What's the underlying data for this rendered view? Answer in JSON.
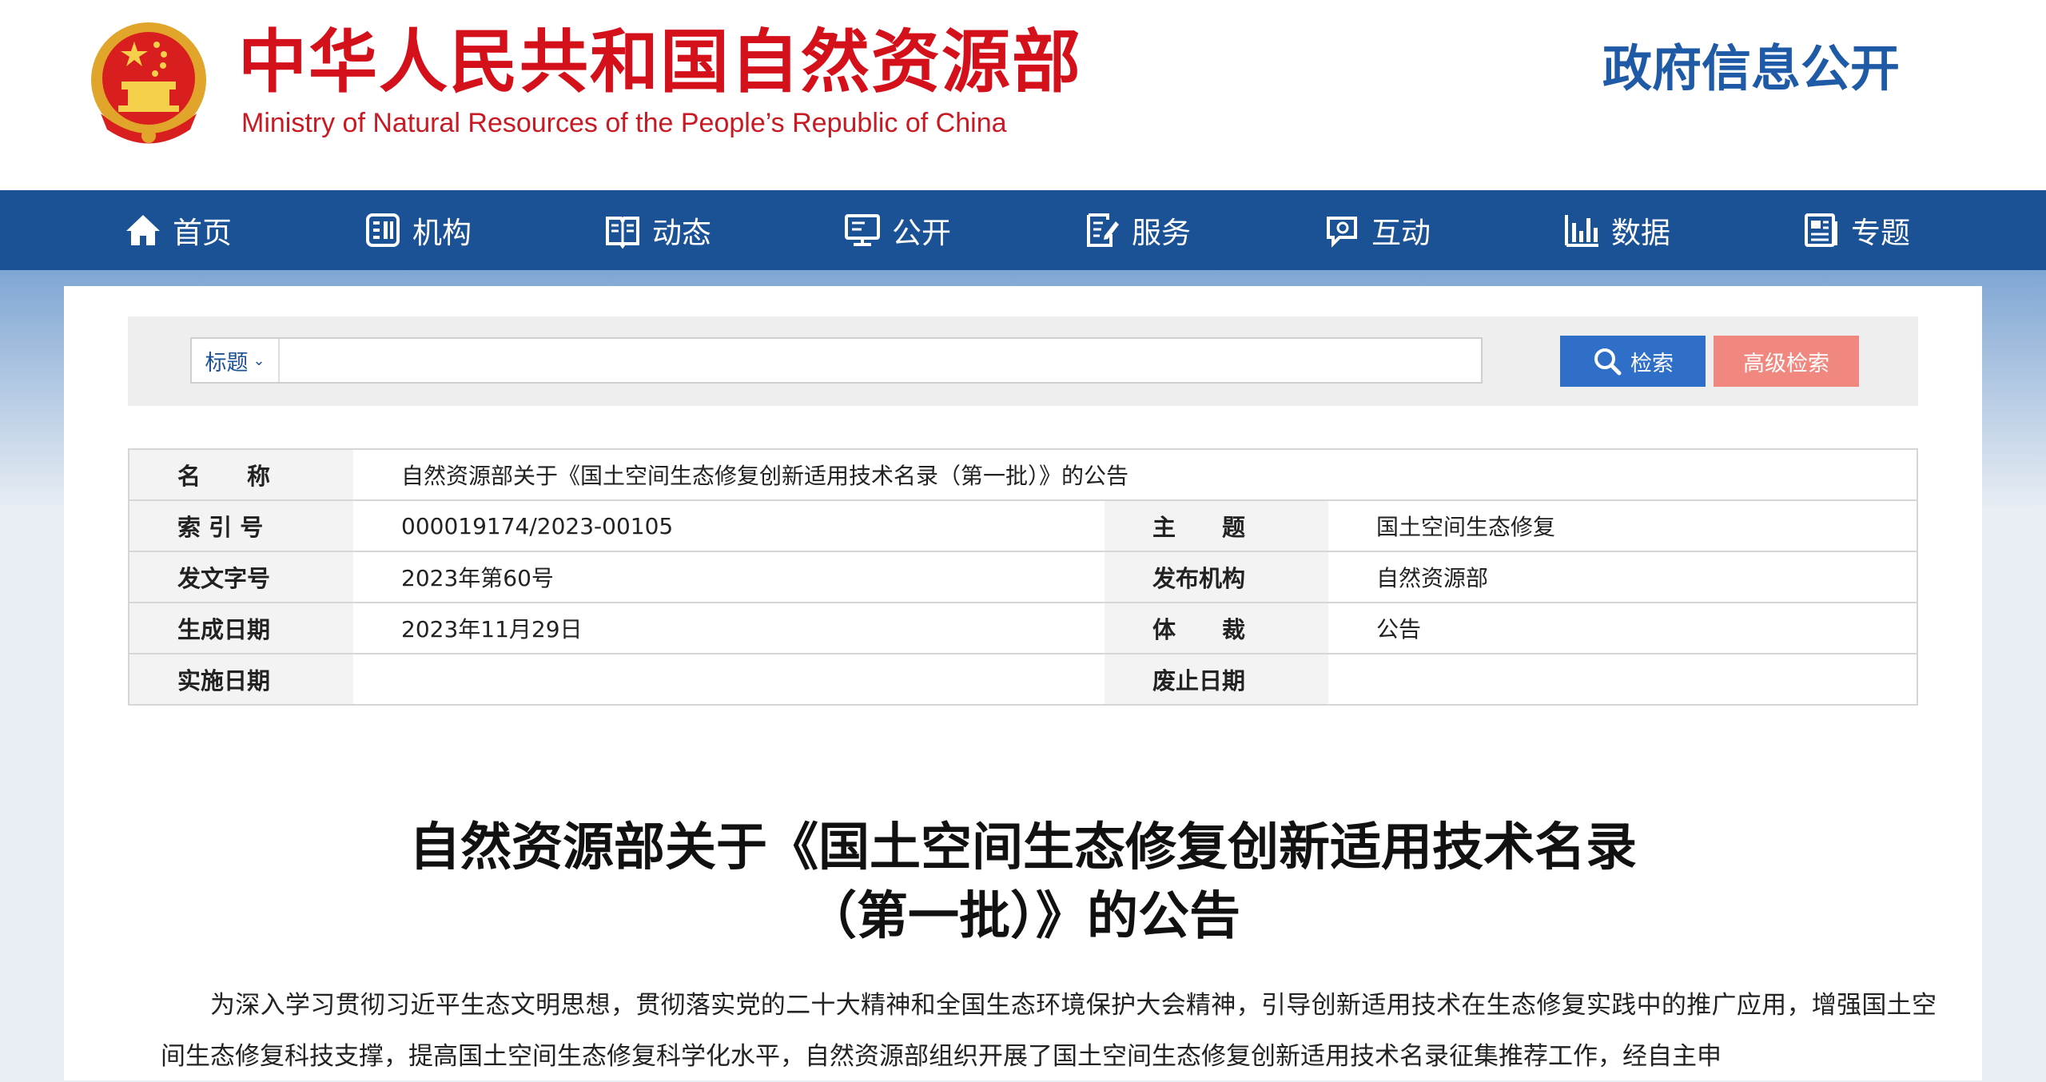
{
  "header": {
    "title_cn": "中华人民共和国自然资源部",
    "title_en": "Ministry of Natural Resources of the People’s Republic of China",
    "right_link": "政府信息公开"
  },
  "nav": {
    "items": [
      {
        "label": "首页",
        "icon": "home-icon"
      },
      {
        "label": "机构",
        "icon": "organization-icon"
      },
      {
        "label": "动态",
        "icon": "book-icon"
      },
      {
        "label": "公开",
        "icon": "monitor-icon"
      },
      {
        "label": "服务",
        "icon": "document-edit-icon"
      },
      {
        "label": "互动",
        "icon": "chat-icon"
      },
      {
        "label": "数据",
        "icon": "bar-chart-icon"
      },
      {
        "label": "专题",
        "icon": "newspaper-icon"
      }
    ]
  },
  "search": {
    "type_label": "标题",
    "value": "",
    "search_label": "检索",
    "advanced_label": "高级检索"
  },
  "info": {
    "name_label": "名　　称",
    "name_value": "自然资源部关于《国土空间生态修复创新适用技术名录（第一批）》的公告",
    "index_label": "索 引 号",
    "index_value": "000019174/2023-00105",
    "topic_label": "主　　题",
    "topic_value": "国土空间生态修复",
    "docno_label": "发文字号",
    "docno_value": "2023年第60号",
    "issuer_label": "发布机构",
    "issuer_value": "自然资源部",
    "date_label": "生成日期",
    "date_value": "2023年11月29日",
    "genre_label": "体　　裁",
    "genre_value": "公告",
    "effective_label": "实施日期",
    "effective_value": "",
    "repeal_label": "废止日期",
    "repeal_value": ""
  },
  "article": {
    "title_line1": "自然资源部关于《国土空间生态修复创新适用技术名录",
    "title_line2": "（第一批）》的公告",
    "paragraph": "为深入学习贯彻习近平生态文明思想，贯彻落实党的二十大精神和全国生态环境保护大会精神，引导创新适用技术在生态修复实践中的推广应用，增强国土空间生态修复科技支撑，提高国土空间生态修复科学化水平，自然资源部组织开展了国土空间生态修复创新适用技术名录征集推荐工作，经自主申"
  },
  "colors": {
    "brand_red": "#d4101b",
    "brand_blue": "#1b5296",
    "search_button": "#2f6fc8",
    "advanced_button": "#f08880"
  }
}
